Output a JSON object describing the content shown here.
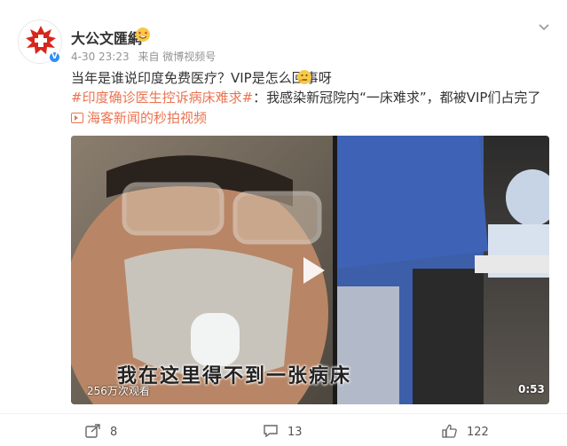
{
  "user": {
    "name": "大公文匯網",
    "avatar_caption": "HKTKW",
    "verified_icon": "verified-badge-icon",
    "emoji": "heart-eyes-emoji"
  },
  "meta": {
    "date": "4-30 23:23",
    "source": "来自 微博视频号"
  },
  "post": {
    "text": "当年是谁说印度免费医疗？VIP是怎么回事呀",
    "emoji": "thinking-emoji",
    "topic": "#印度确诊医生控诉病床难求#",
    "text2": "：我感染新冠院内“一床难求”，都被VIP们占完了",
    "link_label": "海客新闻的秒拍视频"
  },
  "video": {
    "subtitle": "我在这里得不到一张病床",
    "views": "256万次观看",
    "duration": "0:53"
  },
  "footer": {
    "shares": "8",
    "comments": "13",
    "likes": "122"
  },
  "colors": {
    "accent": "#eb7350",
    "meta_gray": "#939393",
    "verified_blue": "#2f8ff1"
  }
}
